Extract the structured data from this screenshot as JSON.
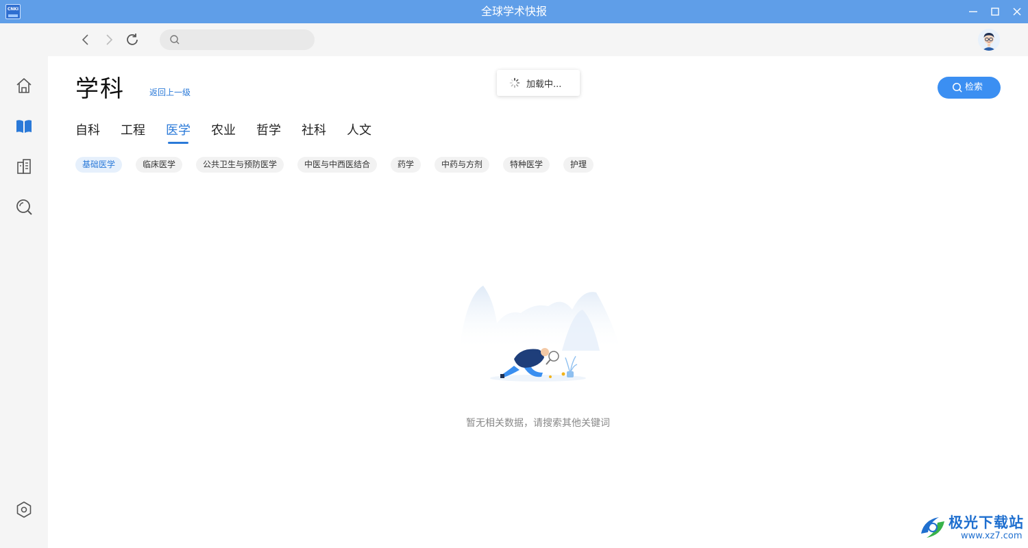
{
  "window": {
    "title": "全球学术快报",
    "logo_text": "CNKI",
    "controls": [
      "minimize-icon",
      "maximize-icon",
      "close-icon"
    ]
  },
  "toolbar": {
    "back_icon": "chevron-left-icon",
    "forward_icon": "chevron-right-icon",
    "refresh_icon": "refresh-icon",
    "search_placeholder": "",
    "search_value": ""
  },
  "sidebar": {
    "items": [
      {
        "icon": "home-icon",
        "active": false
      },
      {
        "icon": "book-icon",
        "active": true
      },
      {
        "icon": "building-icon",
        "active": false
      },
      {
        "icon": "search-icon",
        "active": false
      }
    ],
    "bottom_icon": "settings-icon"
  },
  "main": {
    "title": "学科",
    "back_link": "返回上一级",
    "search_button": "检索",
    "loading_text": "加载中...",
    "tabs": [
      {
        "label": "自科",
        "active": false
      },
      {
        "label": "工程",
        "active": false
      },
      {
        "label": "医学",
        "active": true
      },
      {
        "label": "农业",
        "active": false
      },
      {
        "label": "哲学",
        "active": false
      },
      {
        "label": "社科",
        "active": false
      },
      {
        "label": "人文",
        "active": false
      }
    ],
    "chips": [
      {
        "label": "基础医学",
        "active": true
      },
      {
        "label": "临床医学",
        "active": false
      },
      {
        "label": "公共卫生与预防医学",
        "active": false
      },
      {
        "label": "中医与中西医结合",
        "active": false
      },
      {
        "label": "药学",
        "active": false
      },
      {
        "label": "中药与方剂",
        "active": false
      },
      {
        "label": "特种医学",
        "active": false
      },
      {
        "label": "护理",
        "active": false
      }
    ],
    "empty_text": "暂无相关数据，请搜索其他关键词"
  },
  "watermark": {
    "title": "极光下载站",
    "url": "www.xz7.com"
  },
  "colors": {
    "titlebar": "#5f9ee8",
    "accent": "#2a79d8",
    "button": "#3b8ff2"
  }
}
